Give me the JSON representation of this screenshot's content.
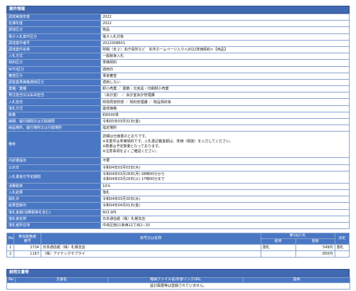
{
  "section_title": "案件情報",
  "info_rows": [
    {
      "label": "調達実施年度",
      "value": "2022"
    },
    {
      "label": "名簿年度",
      "value": "2022"
    },
    {
      "label": "調達区分",
      "value": "物品"
    },
    {
      "label": "電子入札案件区分",
      "value": "電子入札対象"
    },
    {
      "label": "調達案件番号",
      "value": "2022008601"
    },
    {
      "label": "調達案件名称",
      "value": "財閥（年２）本庁役所など　本市ホームページ入り<2022単価契約>【用品】"
    },
    {
      "label": "入札方式",
      "value": "一般競争入札"
    },
    {
      "label": "契約区分",
      "value": "単価契約"
    },
    {
      "label": "WTO区分",
      "value": "適用外"
    },
    {
      "label": "審査区分",
      "value": "事後審査"
    },
    {
      "label": "調査基準価格適用区分",
      "value": "適用しない"
    },
    {
      "label": "業種／業種",
      "value": "卸小売業 ／ 書籍・文房具・印刷卸小売業"
    },
    {
      "label": "発注担当又は払出担当",
      "value": "（会計室） ／ 会計室会計管理課"
    },
    {
      "label": "入札担当",
      "value": "財政局管財部 ／ 契約管理課 ／ 物品契約係"
    },
    {
      "label": "落札方式",
      "value": "最低価格"
    },
    {
      "label": "数量",
      "value": "約6500単"
    },
    {
      "label": "納期、履行期間又は引取期限",
      "value": "令和05年03月31日(金)"
    },
    {
      "label": "納品場所、履行場所又は引取場所",
      "value": "指定場所"
    },
    {
      "label": "備考",
      "value": "詳細は仕様書のとおりです。\n※本案件は単価契約です。入札書記載金額は、単価（税抜）を入力してください。\n※数量は予定数量となっております。\n※注意事項をよくご確認ください。"
    },
    {
      "label": "内訳書提出",
      "value": "不要"
    },
    {
      "label": "公示日",
      "value": "令和04年03月03日(木)"
    },
    {
      "label": "入札書受付予定期間",
      "value": "令和04年03月28日(月) 08時00分から\n令和04年03月29日(火) 17時00分まで"
    },
    {
      "label": "消費税率",
      "value": "10％"
    },
    {
      "label": "入札結果",
      "value": "落札"
    },
    {
      "label": "開札日",
      "value": "令和04年03月30日(水)"
    },
    {
      "label": "結果登録日",
      "value": "令和04年04月01日(金)"
    },
    {
      "label": "落札金額(消費税等を含む)",
      "value": "603.9円"
    },
    {
      "label": "落札者名称",
      "value": "日本通信紙（株）札幌支店"
    },
    {
      "label": "落札者所在地",
      "value": "中央区南11条西12丁目2−33"
    }
  ],
  "bid_table": {
    "headers": {
      "no": "No",
      "reg_no": "参加資格者\n番号",
      "name": "商号又は名称",
      "round1": "第1回入札",
      "result": "結果",
      "amount": "金額",
      "decision": "決定"
    },
    "rows": [
      {
        "no": "1",
        "reg_no": "2734",
        "name": "日本通信紙（株）札幌支店",
        "result": "落札",
        "amount": "549円",
        "decision": "落札"
      },
      {
        "no": "2",
        "reg_no": "1167",
        "name": "（株）アイテックサプライ",
        "result": "",
        "amount": "850円",
        "decision": ""
      }
    ]
  },
  "docs_section": {
    "title": "説明文書等",
    "headers": {
      "no": "No",
      "name": "文書名",
      "file": "格納ファイル名/外部リンクURL",
      "note": "説明"
    },
    "empty_message": "設計図書等は登録されていません。"
  }
}
